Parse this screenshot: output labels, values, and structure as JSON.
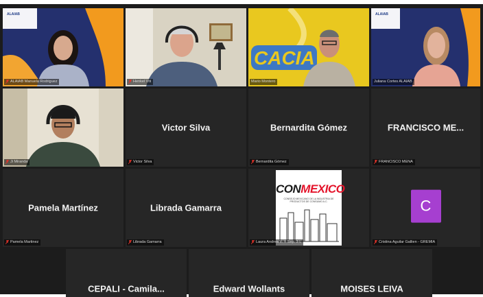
{
  "grid": {
    "row1": [
      {
        "label": "ALAIAB Manuela Rodriguez",
        "logo": "ALAIAB",
        "active": true
      },
      {
        "label": "Henkel Viti"
      },
      {
        "label": "Mario Montero",
        "banner": "CACIA"
      },
      {
        "label": "Juliana Cortes ALAIAB",
        "logo": "ALAIAB"
      }
    ],
    "row2": [
      {
        "label": "Ji Miranda"
      },
      {
        "name": "Victor Silva",
        "label": "Victor Silva"
      },
      {
        "name": "Bernardita Gómez",
        "label": "Bernardita Gómez"
      },
      {
        "name": "FRANCISCO ME...",
        "label": "FRANCISCO MENA"
      }
    ],
    "row3": [
      {
        "name": "Pamela Martínez",
        "label": "Pamela Martinez"
      },
      {
        "name": "Librada Gamarra",
        "label": "Librada Gamarra"
      },
      {
        "label": "Laura Andrea V. Y Sep. 3 L",
        "logo_text_a": "CON",
        "logo_text_b": "MEXICO",
        "logo_sub": "CONSEJO MEXICANO DE LA INDUSTRIA DE PRODUCTOS DE CONSUMO A.C."
      },
      {
        "label": "Cristina Aguilar Gallien - GREMIA",
        "avatar_letter": "C"
      }
    ],
    "row4": [
      {
        "name": "CEPALI  -  Camila..."
      },
      {
        "name": "Edward Wollants"
      },
      {
        "name": "MOISES LEIVA"
      }
    ]
  },
  "colors": {
    "active_border": "#c9ff2e",
    "tile_bg": "#262626",
    "avatar_bg": "#a63fd0",
    "mic_muted": "#e5332a"
  }
}
